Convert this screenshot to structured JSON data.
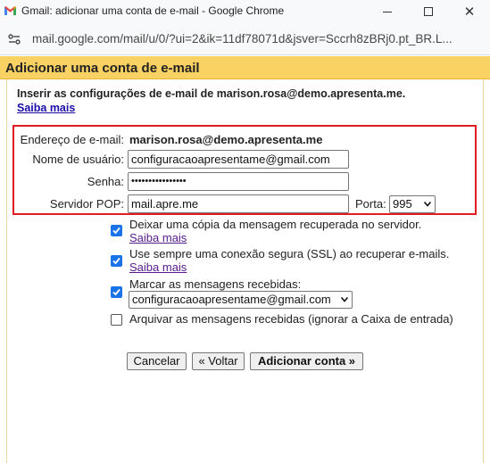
{
  "window": {
    "title": "Gmail: adicionar uma conta de e-mail - Google Chrome",
    "url": "mail.google.com/mail/u/0/?ui=2&ik=11df78071d&jsver=Sccrh8zBRj0.pt_BR.L..."
  },
  "page": {
    "heading": "Adicionar uma conta de e-mail",
    "intro": "Inserir as configurações de e-mail de marison.rosa@demo.apresenta.me.",
    "learn_more": "Saiba mais"
  },
  "form": {
    "email_label": "Endereço de e-mail:",
    "email_value": "marison.rosa@demo.apresenta.me",
    "username_label": "Nome de usuário:",
    "username_value": "configuracaoapresentame@gmail.com",
    "password_label": "Senha:",
    "password_value": "••••••••••••••••",
    "pop_label": "Servidor POP:",
    "pop_value": "mail.apre.me",
    "port_label": "Porta:",
    "port_value": "995"
  },
  "options": [
    {
      "label": "Deixar uma cópia da mensagem recuperada no servidor.",
      "link": "Saiba mais",
      "checked": true
    },
    {
      "label": "Use sempre uma conexão segura (SSL) ao recuperar e-mails.",
      "link": "Saiba mais",
      "checked": true
    },
    {
      "label": "Marcar as mensagens recebidas:",
      "select_value": "configuracaoapresentame@gmail.com",
      "checked": true
    },
    {
      "label": "Arquivar as mensagens recebidas (ignorar a Caixa de entrada)",
      "checked": false
    }
  ],
  "buttons": {
    "cancel": "Cancelar",
    "back": "« Voltar",
    "add": "Adicionar conta »"
  },
  "colors": {
    "header_bg": "#fad163",
    "highlight_border": "#e31b23",
    "checkbox_blue": "#1a73e8",
    "link_blue": "#1a0dab",
    "link_visited": "#551a8b"
  }
}
